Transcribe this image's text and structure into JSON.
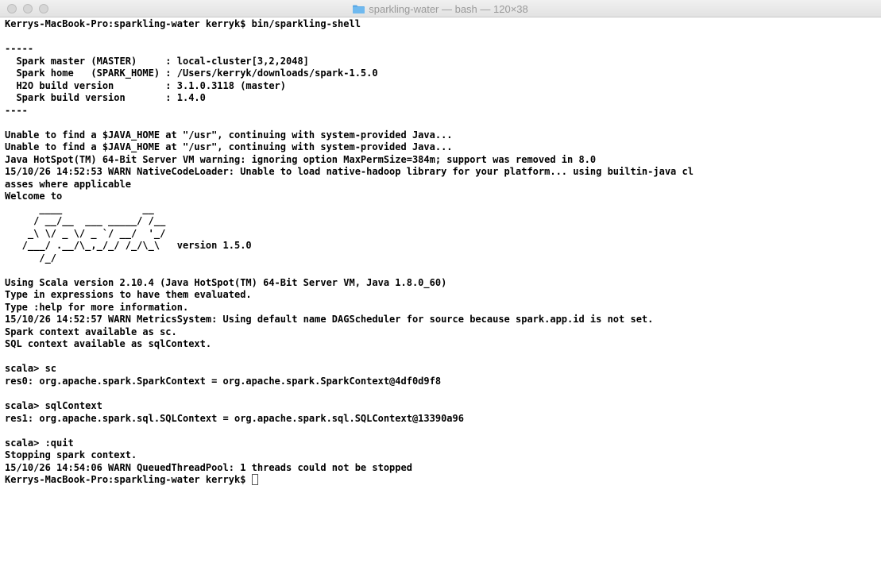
{
  "window": {
    "title": "sparkling-water — bash — 120×38",
    "folder_icon": "folder-icon",
    "icon_color": "#5aa9e6"
  },
  "terminal": {
    "lines": [
      "Kerrys-MacBook-Pro:sparkling-water kerryk$ bin/sparkling-shell",
      "",
      "-----",
      "  Spark master (MASTER)     : local-cluster[3,2,2048]",
      "  Spark home   (SPARK_HOME) : /Users/kerryk/downloads/spark-1.5.0",
      "  H2O build version         : 3.1.0.3118 (master)",
      "  Spark build version       : 1.4.0",
      "----",
      "",
      "Unable to find a $JAVA_HOME at \"/usr\", continuing with system-provided Java...",
      "Unable to find a $JAVA_HOME at \"/usr\", continuing with system-provided Java...",
      "Java HotSpot(TM) 64-Bit Server VM warning: ignoring option MaxPermSize=384m; support was removed in 8.0",
      "15/10/26 14:52:53 WARN NativeCodeLoader: Unable to load native-hadoop library for your platform... using builtin-java cl",
      "asses where applicable",
      "Welcome to",
      "      ____              __",
      "     / __/__  ___ _____/ /__",
      "    _\\ \\/ _ \\/ _ `/ __/  '_/",
      "   /___/ .__/\\_,_/_/ /_/\\_\\   version 1.5.0",
      "      /_/",
      "",
      "Using Scala version 2.10.4 (Java HotSpot(TM) 64-Bit Server VM, Java 1.8.0_60)",
      "Type in expressions to have them evaluated.",
      "Type :help for more information.",
      "15/10/26 14:52:57 WARN MetricsSystem: Using default name DAGScheduler for source because spark.app.id is not set.",
      "Spark context available as sc.",
      "SQL context available as sqlContext.",
      "",
      "scala> sc",
      "res0: org.apache.spark.SparkContext = org.apache.spark.SparkContext@4df0d9f8",
      "",
      "scala> sqlContext",
      "res1: org.apache.spark.sql.SQLContext = org.apache.spark.sql.SQLContext@13390a96",
      "",
      "scala> :quit",
      "Stopping spark context.",
      "15/10/26 14:54:06 WARN QueuedThreadPool: 1 threads could not be stopped",
      "Kerrys-MacBook-Pro:sparkling-water kerryk$ "
    ]
  }
}
